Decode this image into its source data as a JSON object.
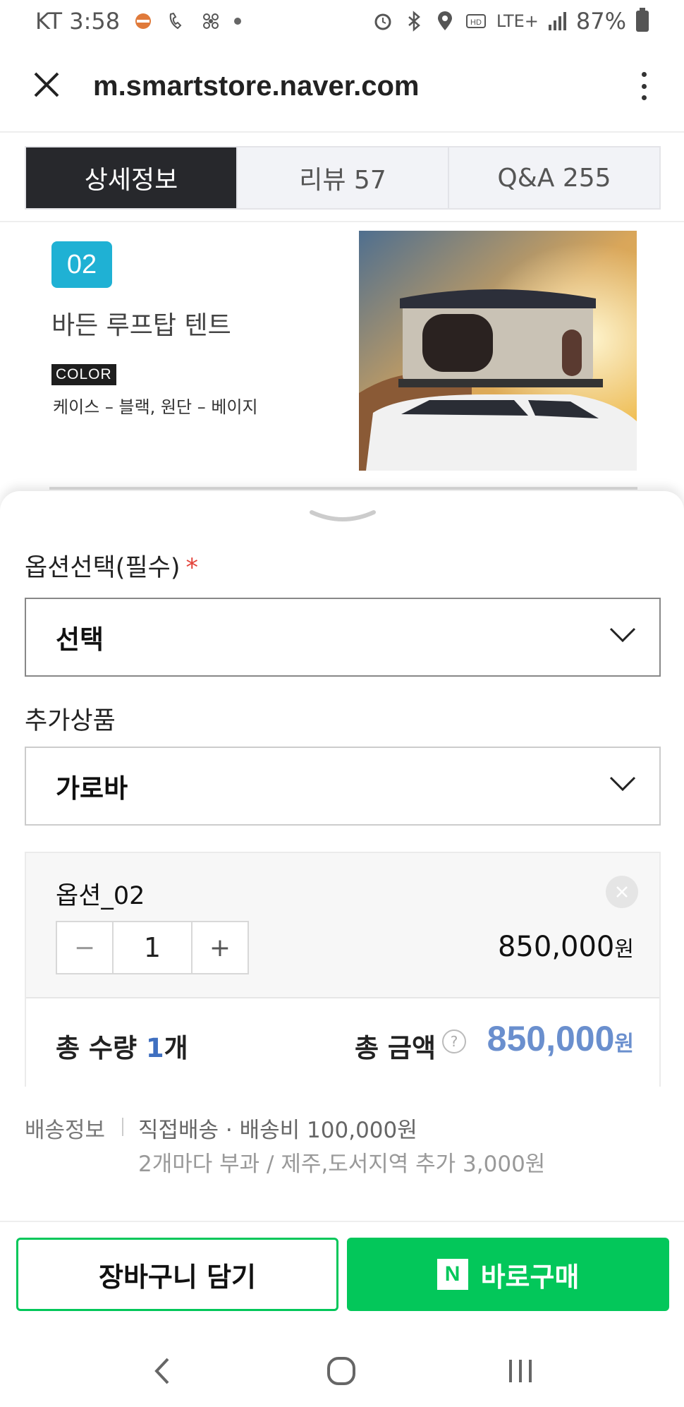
{
  "status_bar": {
    "carrier_time": "KT 3:58",
    "network": "LTE+",
    "battery": "87%",
    "left_icons": [
      "app-notification-icon",
      "wifi-calling-icon",
      "fan-icon"
    ],
    "right_icons": [
      "alarm-icon",
      "bluetooth-icon",
      "location-icon",
      "hd-voice-icon",
      "signal-icon",
      "battery-icon"
    ]
  },
  "browser": {
    "url": "m.smartstore.naver.com",
    "close_icon": "close-icon",
    "menu_icon": "more-vert-icon"
  },
  "tabs": [
    {
      "label": "상세정보",
      "active": true
    },
    {
      "label": "리뷰  57",
      "active": false
    },
    {
      "label": "Q&A  255",
      "active": false
    }
  ],
  "product_preview": {
    "badge": "02",
    "name": "바든 루프탑 텐트",
    "color_tag": "COLOR",
    "color_desc": "케이스 – 블랙, 원단 – 베이지"
  },
  "options": {
    "required_label": "옵션선택(필수)",
    "required_mark": "*",
    "required_value": "선택",
    "extra_label": "추가상품",
    "extra_value": "가로바"
  },
  "selected_option": {
    "name": "옵션_02",
    "quantity": "1",
    "minus": "−",
    "plus": "+",
    "price": "850,000",
    "currency": "원"
  },
  "totals": {
    "qty_prefix": "총 수량 ",
    "qty_num": "1",
    "qty_suffix": "개",
    "amount_label": "총 금액",
    "help": "?",
    "amount": "850,000",
    "currency": "원"
  },
  "shipping": {
    "label": "배송정보",
    "line1": "직접배송 · 배송비 100,000원",
    "line2": "2개마다 부과 / 제주,도서지역 추가 3,000원"
  },
  "actions": {
    "cart": "장바구니 담기",
    "buy": "바로구매",
    "buy_logo": "N"
  },
  "colors": {
    "accent_green": "#03c75a",
    "badge_blue": "#1fb1d4",
    "total_blue": "#6a8fce",
    "tab_active": "#27282c",
    "required_red": "#e3443b"
  },
  "nav": [
    "back-icon",
    "home-icon",
    "recents-icon"
  ]
}
